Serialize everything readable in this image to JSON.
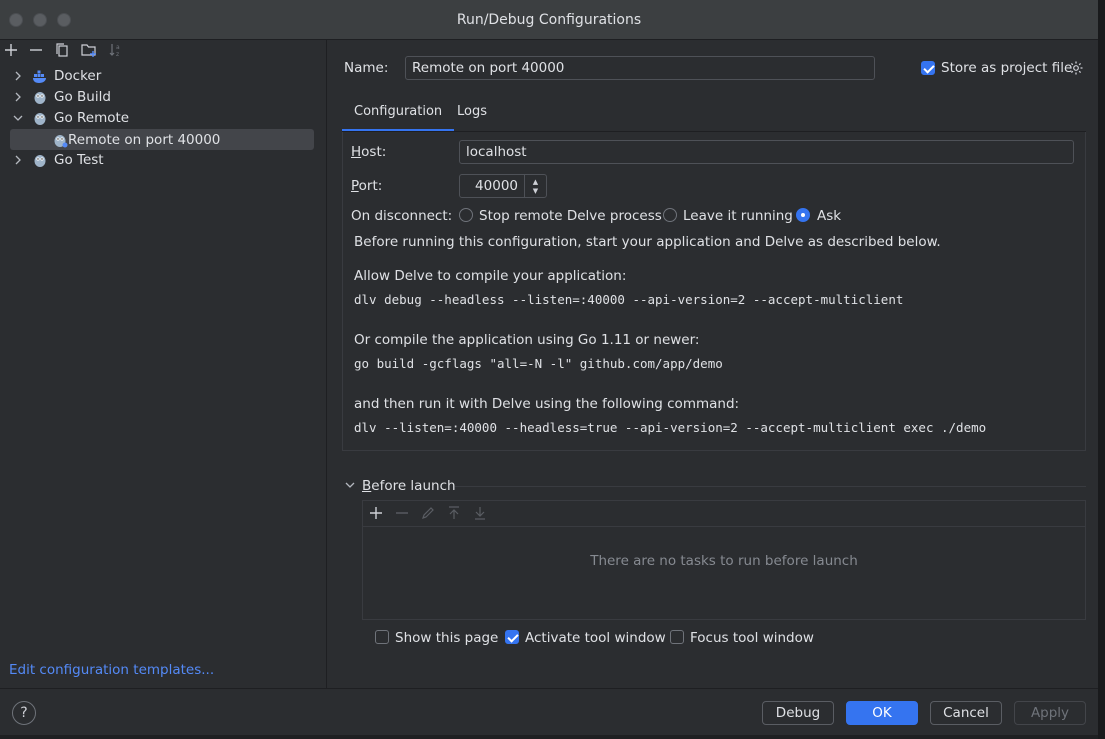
{
  "window": {
    "title": "Run/Debug Configurations"
  },
  "sidebar": {
    "toolbar_icons": [
      "add-icon",
      "remove-icon",
      "copy-icon",
      "new-folder-icon",
      "sort-icon"
    ],
    "tree": [
      {
        "label": "Docker",
        "icon": "docker-icon",
        "expanded": false
      },
      {
        "label": "Go Build",
        "icon": "gopher-icon",
        "expanded": false
      },
      {
        "label": "Go Remote",
        "icon": "gopher-icon",
        "expanded": true
      },
      {
        "label": "Remote on port 40000",
        "icon": "gopher-remote-icon",
        "selected": true
      },
      {
        "label": "Go Test",
        "icon": "gopher-icon",
        "expanded": false
      }
    ],
    "edit_templates_link": "Edit configuration templates..."
  },
  "form": {
    "name_label": "Name:",
    "name_value": "Remote on port 40000",
    "store_project_file_label": "Store as project file",
    "store_project_file_checked": true,
    "tabs": [
      {
        "label": "Configuration",
        "active": true
      },
      {
        "label": "Logs",
        "active": false
      }
    ],
    "host_label": "Host:",
    "host_value": "localhost",
    "port_label": "Port:",
    "port_value": "40000",
    "on_disconnect_label": "On disconnect:",
    "on_disconnect_options": [
      {
        "label": "Stop remote Delve process",
        "selected": false
      },
      {
        "label": "Leave it running",
        "selected": false
      },
      {
        "label": "Ask",
        "selected": true
      }
    ],
    "info_intro": "Before running this configuration, start your application and Delve as described below.",
    "info_allow": "Allow Delve to compile your application:",
    "cmd_debug": "dlv debug --headless --listen=:40000 --api-version=2 --accept-multiclient",
    "info_compile": "Or compile the application using Go 1.11 or newer:",
    "cmd_build": "go build -gcflags \"all=-N -l\" github.com/app/demo",
    "info_run": "and then run it with Delve using the following command:",
    "cmd_exec": "dlv --listen=:40000 --headless=true --api-version=2 --accept-multiclient exec ./demo"
  },
  "before_launch": {
    "title": "Before launch",
    "toolbar_icons": [
      "add-icon",
      "remove-icon",
      "edit-icon",
      "move-up-icon",
      "move-down-icon"
    ],
    "empty_text": "There are no tasks to run before launch",
    "show_this_page_label": "Show this page",
    "show_this_page_checked": false,
    "activate_tool_window_label": "Activate tool window",
    "activate_tool_window_checked": true,
    "focus_tool_window_label": "Focus tool window",
    "focus_tool_window_checked": false
  },
  "footer": {
    "help": "?",
    "debug": "Debug",
    "ok": "OK",
    "cancel": "Cancel",
    "apply": "Apply"
  },
  "colors": {
    "accent": "#3574f0",
    "link": "#548af7",
    "background": "#2b2d30"
  }
}
